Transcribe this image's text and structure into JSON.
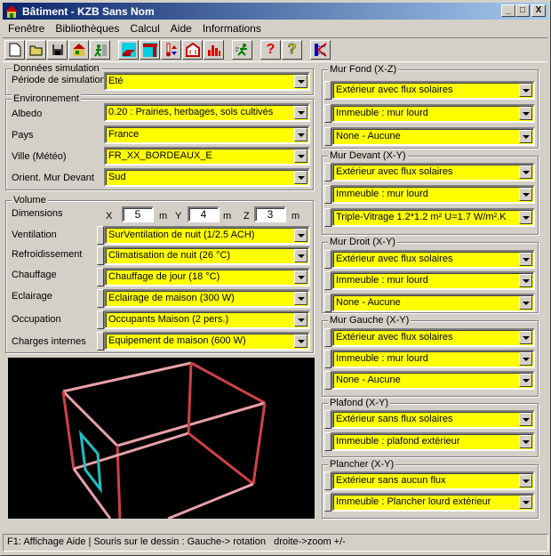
{
  "window": {
    "title": "Bâtiment - KZB Sans Nom",
    "minimize": "_",
    "maximize": "□",
    "close": "X"
  },
  "menu": [
    "Fenêtre",
    "Bibliothèques",
    "Calcul",
    "Aide",
    "Informations"
  ],
  "toolbar": [
    "new-file",
    "open-folder",
    "save-disk",
    "building",
    "exit-door",
    "material-brick",
    "wall-section",
    "thermometer-exchange",
    "building-flows",
    "bar-chart",
    "run-man",
    "help-red",
    "help-yellow",
    "k-logo"
  ],
  "simulation": {
    "group": "Données simulation",
    "period_label": "Période de simulation",
    "period_value": "Eté"
  },
  "environment": {
    "group": "Environnement",
    "albedo_label": "Albedo",
    "albedo_value": "0.20 : Prairies, herbages, sols cultivés",
    "country_label": "Pays",
    "country_value": "France",
    "city_label": "Ville (Météo)",
    "city_value": "FR_XX_BORDEAUX_E",
    "orient_label": "Orient. Mur Devant",
    "orient_value": "Sud"
  },
  "volume": {
    "group": "Volume",
    "dims_label": "Dimensions",
    "x_label": "X",
    "x": "5",
    "y_label": "Y",
    "y": "4",
    "z_label": "Z",
    "z": "3",
    "unit": "m",
    "rows": [
      {
        "label": "Ventilation",
        "value": "SurVentilation de nuit (1/2.5 ACH)"
      },
      {
        "label": "Refroidissement",
        "value": "Climatisation de nuit (26 °C)"
      },
      {
        "label": "Chauffage",
        "value": "Chauffage de jour (18 °C)"
      },
      {
        "label": "Eclairage",
        "value": "Eclairage de maison (300 W)"
      },
      {
        "label": "Occupation",
        "value": "Occupants Maison (2 pers.)"
      },
      {
        "label": "Charges internes",
        "value": "Equipement de maison (600 W)"
      }
    ]
  },
  "walls": [
    {
      "title": "Mur Fond (X-Z)",
      "values": [
        "Extérieur avec flux solaires",
        "Immeuble : mur lourd",
        "None - Aucune"
      ]
    },
    {
      "title": "Mur Devant (X-Y)",
      "values": [
        "Extérieur avec flux solaires",
        "Immeuble : mur lourd",
        "Triple-Vitrage 1.2*1.2 m² U=1.7 W/m².K"
      ]
    },
    {
      "title": "Mur Droit (X-Y)",
      "values": [
        "Extérieur avec flux solaires",
        "Immeuble : mur lourd",
        "None - Aucune"
      ]
    },
    {
      "title": "Mur Gauche (X-Y)",
      "values": [
        "Extérieur avec flux solaires",
        "Immeuble : mur lourd",
        "None - Aucune"
      ]
    },
    {
      "title": "Plafond (X-Y)",
      "values": [
        "Extérieur sans flux solaires",
        "Immeuble : plafond extérieur"
      ]
    },
    {
      "title": "Plancher (X-Y)",
      "values": [
        "Extérieur sans aucun flux",
        "Immeuble : Plancher lourd extérieur"
      ]
    }
  ],
  "status": "F1: Affichage Aide | Souris sur le dessin : Gauche-> rotation   droite->zoom +/-",
  "colors": {
    "field": "#ffff00",
    "edge": "#d04048",
    "edge_light": "#e8a0a8",
    "window": "#20c0c0"
  }
}
